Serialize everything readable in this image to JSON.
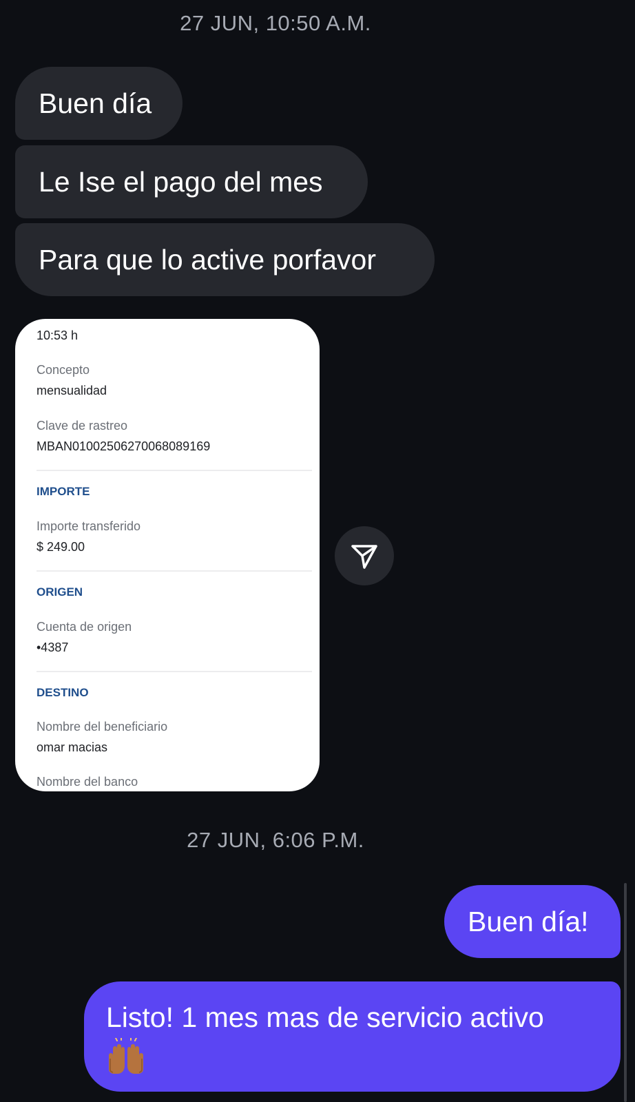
{
  "conversation": {
    "timestamps": [
      "27 JUN, 10:50 A.M.",
      "27 JUN, 6:06 P.M."
    ],
    "incoming_messages": [
      "Buen día",
      "Le Ise el pago del mes",
      "Para que lo active porfavor"
    ],
    "outgoing_messages": [
      "Buen día!",
      "Listo! 1 mes mas de servicio activo"
    ]
  },
  "receipt": {
    "time": "10:53 h",
    "concepto_label": "Concepto",
    "concepto_value": "mensualidad",
    "clave_label": "Clave de rastreo",
    "clave_value": "MBAN01002506270068089169",
    "importe_section": "IMPORTE",
    "importe_label": "Importe transferido",
    "importe_value": "$ 249.00",
    "origen_section": "ORIGEN",
    "cuenta_label": "Cuenta de origen",
    "cuenta_value": "•4387",
    "destino_section": "DESTINO",
    "beneficiario_label": "Nombre del beneficiario",
    "beneficiario_value": "omar macias",
    "banco_label": "Nombre del banco"
  },
  "icons": {
    "share": "paper-plane-icon",
    "emoji": "raising-hands-emoji"
  },
  "colors": {
    "background": "#0d0f14",
    "incoming_bubble": "#26282e",
    "outgoing_bubble": "#5b45f3",
    "timestamp": "#a7abb4",
    "receipt_section": "#1f4e8c"
  }
}
